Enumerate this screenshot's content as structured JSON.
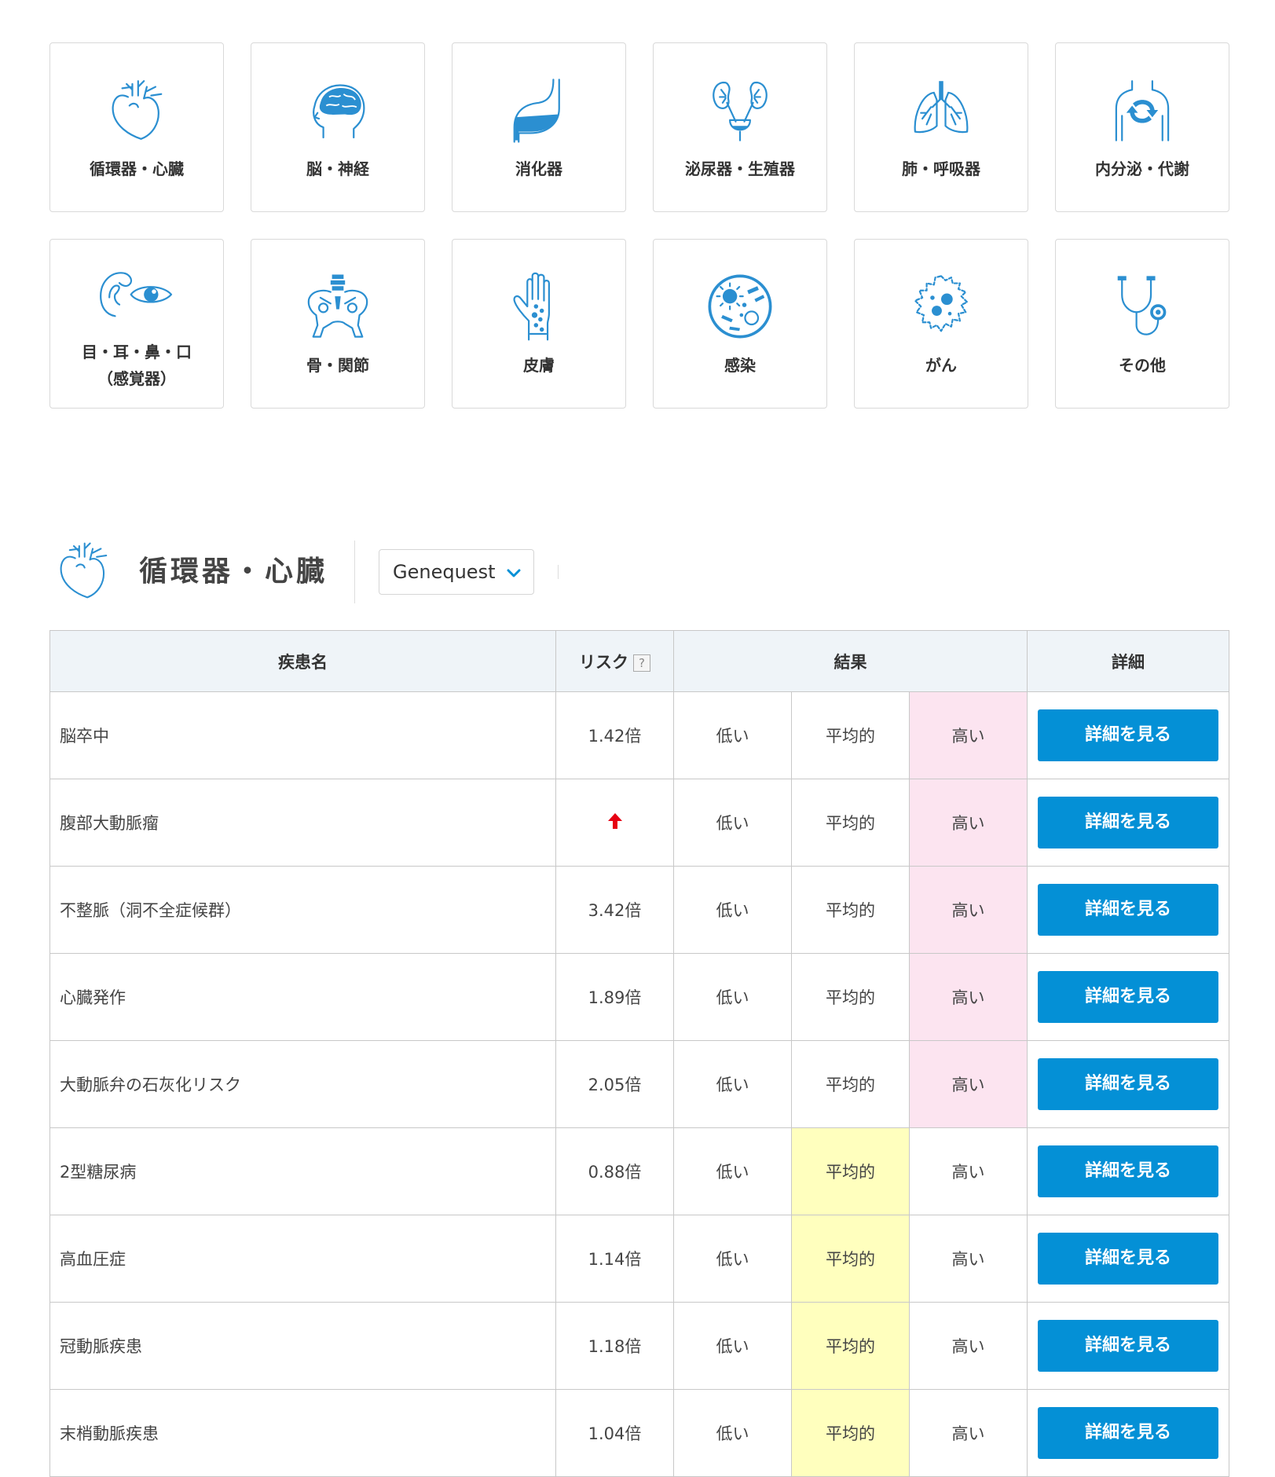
{
  "categories": [
    {
      "label": "循環器・心臓",
      "icon": "heart-icon"
    },
    {
      "label": "脳・神経",
      "icon": "brain-icon"
    },
    {
      "label": "消化器",
      "icon": "stomach-icon"
    },
    {
      "label": "泌尿器・生殖器",
      "icon": "kidney-icon"
    },
    {
      "label": "肺・呼吸器",
      "icon": "lungs-icon"
    },
    {
      "label": "内分泌・代謝",
      "icon": "metabolism-icon"
    },
    {
      "label": "目・耳・鼻・口\n（感覚器）",
      "icon": "eye-ear-icon"
    },
    {
      "label": "骨・関節",
      "icon": "pelvis-icon"
    },
    {
      "label": "皮膚",
      "icon": "skin-hand-icon"
    },
    {
      "label": "感染",
      "icon": "bacteria-icon"
    },
    {
      "label": "がん",
      "icon": "cancer-cell-icon"
    },
    {
      "label": "その他",
      "icon": "stethoscope-icon"
    }
  ],
  "section": {
    "title": "循環器・心臓",
    "icon": "heart-icon",
    "source_select": "Genequest"
  },
  "table": {
    "headers": {
      "name": "疾患名",
      "risk": "リスク",
      "risk_help": "?",
      "result": "結果",
      "detail": "詳細"
    },
    "levels": {
      "low": "低い",
      "mid": "平均的",
      "high": "高い"
    },
    "detail_button": "詳細を見る",
    "rows": [
      {
        "name": "脳卒中",
        "risk": "1.42倍",
        "result": "high"
      },
      {
        "name": "腹部大動脈瘤",
        "risk": "",
        "risk_icon": "up-arrow-icon",
        "result": "high"
      },
      {
        "name": "不整脈（洞不全症候群）",
        "risk": "3.42倍",
        "result": "high"
      },
      {
        "name": "心臓発作",
        "risk": "1.89倍",
        "result": "high"
      },
      {
        "name": "大動脈弁の石灰化リスク",
        "risk": "2.05倍",
        "result": "high"
      },
      {
        "name": "2型糖尿病",
        "risk": "0.88倍",
        "result": "mid"
      },
      {
        "name": "高血圧症",
        "risk": "1.14倍",
        "result": "mid"
      },
      {
        "name": "冠動脈疾患",
        "risk": "1.18倍",
        "result": "mid"
      },
      {
        "name": "末梢動脈疾患",
        "risk": "1.04倍",
        "result": "mid"
      }
    ]
  },
  "colors": {
    "accent": "#0490d6",
    "icon": "#2b8fd1",
    "high_bg": "#fce4f0",
    "mid_bg": "#ffffbe",
    "header_bg": "#eff4f8",
    "arrow": "#e60012"
  }
}
